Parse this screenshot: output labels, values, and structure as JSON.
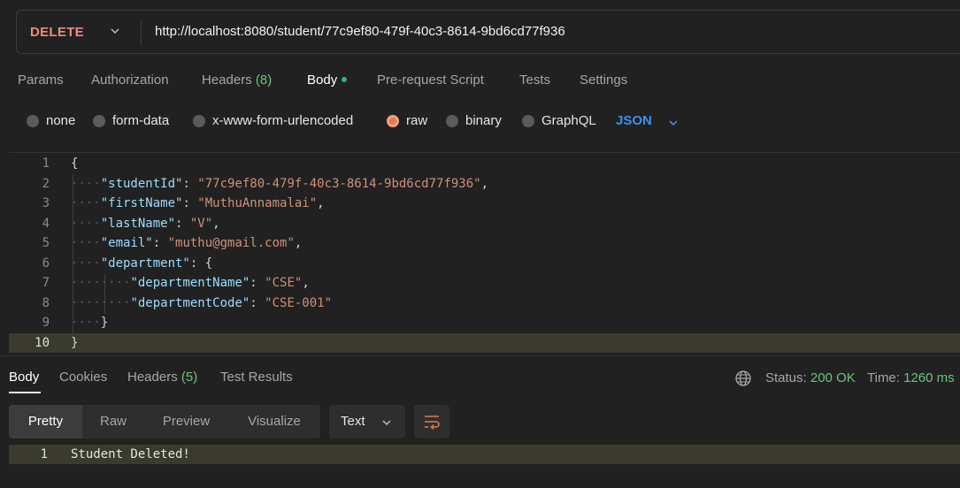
{
  "request": {
    "method": "DELETE",
    "url": "http://localhost:8080/student/77c9ef80-479f-40c3-8614-9bd6cd77f936"
  },
  "request_tabs": {
    "params": "Params",
    "authorization": "Authorization",
    "headers": "Headers",
    "headers_count": "(8)",
    "body": "Body",
    "prerequest": "Pre-request Script",
    "tests": "Tests",
    "settings": "Settings"
  },
  "body_types": {
    "none": "none",
    "form_data": "form-data",
    "urlencoded": "x-www-form-urlencoded",
    "raw": "raw",
    "binary": "binary",
    "graphql": "GraphQL",
    "selected": "raw",
    "format": "JSON"
  },
  "editor": {
    "lines": [
      {
        "n": "1",
        "key": "",
        "val": ""
      },
      {
        "n": "2",
        "key": "\"studentId\"",
        "val": "\"77c9ef80-479f-40c3-8614-9bd6cd77f936\""
      },
      {
        "n": "3",
        "key": "\"firstName\"",
        "val": "\"MuthuAnnamalai\""
      },
      {
        "n": "4",
        "key": "\"lastName\"",
        "val": "\"V\""
      },
      {
        "n": "5",
        "key": "\"email\"",
        "val": "\"muthu@gmail.com\""
      },
      {
        "n": "6",
        "key": "\"department\"",
        "val": ""
      },
      {
        "n": "7",
        "key": "\"departmentName\"",
        "val": "\"CSE\""
      },
      {
        "n": "8",
        "key": "\"departmentCode\"",
        "val": "\"CSE-001\""
      },
      {
        "n": "9",
        "key": "",
        "val": ""
      },
      {
        "n": "10",
        "key": "",
        "val": ""
      }
    ]
  },
  "response_tabs": {
    "body": "Body",
    "cookies": "Cookies",
    "headers": "Headers",
    "headers_count": "(5)",
    "test_results": "Test Results"
  },
  "status": {
    "status_label": "Status:",
    "status_value": "200 OK",
    "time_label": "Time:",
    "time_value": "1260 ms"
  },
  "format_bar": {
    "pretty": "Pretty",
    "raw": "Raw",
    "preview": "Preview",
    "visualize": "Visualize",
    "type": "Text"
  },
  "response": {
    "line_no": "1",
    "text": "Student Deleted!"
  },
  "icons": {
    "globe": "globe-icon",
    "wrap": "wrap-lines-icon",
    "chevron": "chevron-down-icon"
  },
  "colors": {
    "method": "#f08b7a",
    "accent_green": "#6cc57a",
    "json_blue": "#3d8ef0",
    "raw_selected": "#e07b4f"
  }
}
